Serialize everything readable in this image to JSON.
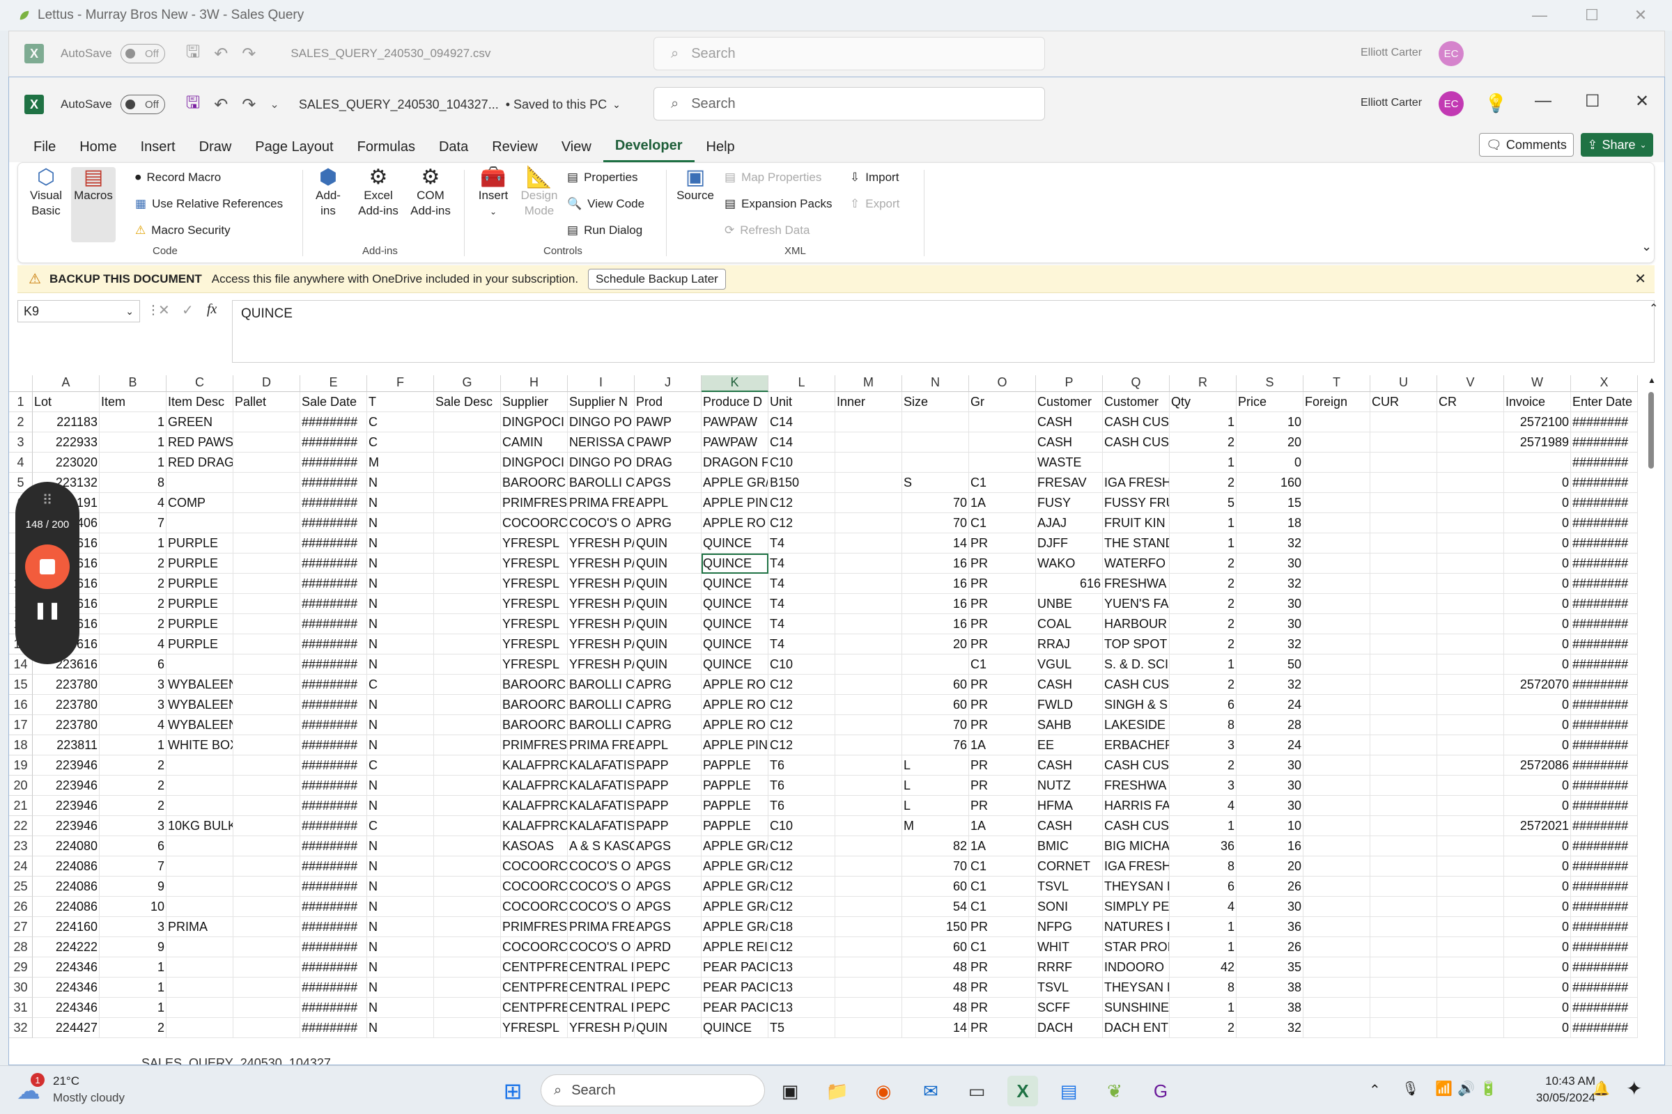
{
  "outer_window": {
    "title": "Lettus - Murray Bros New - 3W - Sales Query"
  },
  "back_window": {
    "autosave_label": "AutoSave",
    "autosave_state": "Off",
    "filename": "SALES_QUERY_240530_094927.csv",
    "search_placeholder": "Search",
    "user": "Elliott Carter",
    "user_initials": "EC"
  },
  "main_window": {
    "autosave_label": "AutoSave",
    "autosave_state": "Off",
    "filename": "SALES_QUERY_240530_104327...",
    "save_status": "• Saved to this PC",
    "search_placeholder": "Search",
    "user": "Elliott Carter",
    "user_initials": "EC"
  },
  "menu": [
    "File",
    "Home",
    "Insert",
    "Draw",
    "Page Layout",
    "Formulas",
    "Data",
    "Review",
    "View",
    "Developer",
    "Help"
  ],
  "menu_active_index": 9,
  "comments_label": "Comments",
  "share_label": "Share",
  "ribbon": {
    "visual_basic": "Visual Basic",
    "macros": "Macros",
    "record_macro": "Record Macro",
    "use_relative": "Use Relative References",
    "macro_security": "Macro Security",
    "code_group": "Code",
    "add_ins": "Add-ins",
    "excel_add_ins": "Excel Add-ins",
    "com_add_ins": "COM Add-ins",
    "add_ins_group": "Add-ins",
    "insert": "Insert",
    "design_mode": "Design Mode",
    "properties": "Properties",
    "view_code": "View Code",
    "run_dialog": "Run Dialog",
    "controls_group": "Controls",
    "source": "Source",
    "map_properties": "Map Properties",
    "expansion_packs": "Expansion Packs",
    "refresh_data": "Refresh Data",
    "import": "Import",
    "export": "Export",
    "xml_group": "XML"
  },
  "message_bar": {
    "title": "BACKUP THIS DOCUMENT",
    "text": "Access this file anywhere with OneDrive included in your subscription.",
    "button": "Schedule Backup Later"
  },
  "formula_bar": {
    "name_box": "K9",
    "fx": "fx",
    "content": "QUINCE"
  },
  "columns": [
    "A",
    "B",
    "C",
    "D",
    "E",
    "F",
    "G",
    "H",
    "I",
    "J",
    "K",
    "L",
    "M",
    "N",
    "O",
    "P",
    "Q",
    "R",
    "S",
    "T",
    "U",
    "V",
    "W",
    "X"
  ],
  "selected_column": "K",
  "active_cell": {
    "row": 9,
    "col": 10
  },
  "rows": [
    [
      "Lot",
      "Item",
      "Item Desc",
      "Pallet",
      "Sale Date",
      "T",
      "Sale Desc",
      "Supplier",
      "Supplier N",
      "Prod",
      "Produce D",
      "Unit",
      "Inner",
      "Size",
      "Gr",
      "Customer",
      "Customer",
      "Qty",
      "Price",
      "Foreign",
      "CUR",
      "CR",
      "Invoice",
      "Enter Date"
    ],
    [
      "221183",
      "1",
      "GREEN",
      "",
      "########",
      "C",
      "",
      "DINGPOCI",
      "DINGO PO",
      "PAWP",
      "PAWPAW",
      "C14",
      "",
      "",
      "",
      "CASH",
      "CASH CUS",
      "1",
      "10",
      "",
      "",
      "",
      "2572100",
      "########"
    ],
    [
      "222933",
      "1",
      "RED PAWS",
      "",
      "########",
      "C",
      "",
      "CAMIN",
      "NERISSA C",
      "PAWP",
      "PAWPAW",
      "C14",
      "",
      "",
      "",
      "CASH",
      "CASH CUS",
      "2",
      "20",
      "",
      "",
      "",
      "2571989",
      "########"
    ],
    [
      "223020",
      "1",
      "RED DRAGONFRUIT",
      "",
      "########",
      "M",
      "",
      "DINGPOCI",
      "DINGO PO",
      "DRAG",
      "DRAGON F",
      "C10",
      "",
      "",
      "",
      "WASTE",
      "",
      "1",
      "0",
      "",
      "",
      "",
      "",
      "########"
    ],
    [
      "223132",
      "8",
      "",
      "",
      "########",
      "N",
      "",
      "BAROORC",
      "BAROLLI C",
      "APGS",
      "APPLE GR/",
      "B150",
      "",
      "S",
      "C1",
      "FRESAV",
      "IGA FRESH",
      "2",
      "160",
      "",
      "",
      "",
      "0",
      "########"
    ],
    [
      "223191",
      "4",
      "COMP",
      "",
      "########",
      "N",
      "",
      "PRIMFRES",
      "PRIMA FRE",
      "APPL",
      "APPLE PIN",
      "C12",
      "",
      "70",
      "1A",
      "FUSY",
      "FUSSY FRU",
      "5",
      "15",
      "",
      "",
      "",
      "0",
      "########"
    ],
    [
      "223406",
      "7",
      "",
      "",
      "########",
      "N",
      "",
      "COCOORC",
      "COCO'S O",
      "APRG",
      "APPLE RO",
      "C12",
      "",
      "70",
      "C1",
      "AJAJ",
      "FRUIT KIN",
      "1",
      "18",
      "",
      "",
      "",
      "0",
      "########"
    ],
    [
      "223616",
      "1",
      "PURPLE",
      "",
      "########",
      "N",
      "",
      "YFRESPL",
      "YFRESH P/",
      "QUIN",
      "QUINCE",
      "T4",
      "",
      "14",
      "PR",
      "DJFF",
      "THE STAND",
      "1",
      "32",
      "",
      "",
      "",
      "0",
      "########"
    ],
    [
      "223616",
      "2",
      "PURPLE",
      "",
      "########",
      "N",
      "",
      "YFRESPL",
      "YFRESH P/",
      "QUIN",
      "QUINCE",
      "T4",
      "",
      "16",
      "PR",
      "WAKO",
      "WATERFO",
      "2",
      "30",
      "",
      "",
      "",
      "0",
      "########"
    ],
    [
      "223616",
      "2",
      "PURPLE",
      "",
      "########",
      "N",
      "",
      "YFRESPL",
      "YFRESH P/",
      "QUIN",
      "QUINCE",
      "T4",
      "",
      "16",
      "PR",
      "616",
      "FRESHWA",
      "2",
      "32",
      "",
      "",
      "",
      "0",
      "########"
    ],
    [
      "223616",
      "2",
      "PURPLE",
      "",
      "########",
      "N",
      "",
      "YFRESPL",
      "YFRESH P/",
      "QUIN",
      "QUINCE",
      "T4",
      "",
      "16",
      "PR",
      "UNBE",
      "YUEN'S FA",
      "2",
      "30",
      "",
      "",
      "",
      "0",
      "########"
    ],
    [
      "223616",
      "2",
      "PURPLE",
      "",
      "########",
      "N",
      "",
      "YFRESPL",
      "YFRESH P/",
      "QUIN",
      "QUINCE",
      "T4",
      "",
      "16",
      "PR",
      "COAL",
      "HARBOUR",
      "2",
      "30",
      "",
      "",
      "",
      "0",
      "########"
    ],
    [
      "223616",
      "4",
      "PURPLE",
      "",
      "########",
      "N",
      "",
      "YFRESPL",
      "YFRESH P/",
      "QUIN",
      "QUINCE",
      "T4",
      "",
      "20",
      "PR",
      "RRAJ",
      "TOP SPOT",
      "2",
      "32",
      "",
      "",
      "",
      "0",
      "########"
    ],
    [
      "223616",
      "6",
      "",
      "",
      "########",
      "N",
      "",
      "YFRESPL",
      "YFRESH P/",
      "QUIN",
      "QUINCE",
      "C10",
      "",
      "",
      "C1",
      "VGUL",
      "S. & D. SCI",
      "1",
      "50",
      "",
      "",
      "",
      "0",
      "########"
    ],
    [
      "223780",
      "3",
      "WYBALEENA",
      "",
      "########",
      "C",
      "",
      "BAROORC",
      "BAROLLI C",
      "APRG",
      "APPLE RO",
      "C12",
      "",
      "60",
      "PR",
      "CASH",
      "CASH CUS",
      "2",
      "32",
      "",
      "",
      "",
      "2572070",
      "########"
    ],
    [
      "223780",
      "3",
      "WYBALEENA",
      "",
      "########",
      "N",
      "",
      "BAROORC",
      "BAROLLI C",
      "APRG",
      "APPLE RO",
      "C12",
      "",
      "60",
      "PR",
      "FWLD",
      "SINGH & S",
      "6",
      "24",
      "",
      "",
      "",
      "0",
      "########"
    ],
    [
      "223780",
      "4",
      "WYBALEENA",
      "",
      "########",
      "N",
      "",
      "BAROORC",
      "BAROLLI C",
      "APRG",
      "APPLE RO",
      "C12",
      "",
      "70",
      "PR",
      "SAHB",
      "LAKESIDE",
      "8",
      "28",
      "",
      "",
      "",
      "0",
      "########"
    ],
    [
      "223811",
      "1",
      "WHITE BOX",
      "",
      "########",
      "N",
      "",
      "PRIMFRES",
      "PRIMA FRE",
      "APPL",
      "APPLE PIN",
      "C12",
      "",
      "76",
      "1A",
      "EE",
      "ERBACHER",
      "3",
      "24",
      "",
      "",
      "",
      "0",
      "########"
    ],
    [
      "223946",
      "2",
      "",
      "",
      "########",
      "C",
      "",
      "KALAFPRC",
      "KALAFATIS",
      "PAPP",
      "PAPPLE",
      "T6",
      "",
      "L",
      "PR",
      "CASH",
      "CASH CUS",
      "2",
      "30",
      "",
      "",
      "",
      "2572086",
      "########"
    ],
    [
      "223946",
      "2",
      "",
      "",
      "########",
      "N",
      "",
      "KALAFPRC",
      "KALAFATIS",
      "PAPP",
      "PAPPLE",
      "T6",
      "",
      "L",
      "PR",
      "NUTZ",
      "FRESHWA",
      "3",
      "30",
      "",
      "",
      "",
      "0",
      "########"
    ],
    [
      "223946",
      "2",
      "",
      "",
      "########",
      "N",
      "",
      "KALAFPRC",
      "KALAFATIS",
      "PAPP",
      "PAPPLE",
      "T6",
      "",
      "L",
      "PR",
      "HFMA",
      "HARRIS FA",
      "4",
      "30",
      "",
      "",
      "",
      "0",
      "########"
    ],
    [
      "223946",
      "3",
      "10KG BULK",
      "",
      "########",
      "C",
      "",
      "KALAFPRC",
      "KALAFATIS",
      "PAPP",
      "PAPPLE",
      "C10",
      "",
      "M",
      "1A",
      "CASH",
      "CASH CUS",
      "1",
      "10",
      "",
      "",
      "",
      "2572021",
      "########"
    ],
    [
      "224080",
      "6",
      "",
      "",
      "########",
      "N",
      "",
      "KASOAS",
      "A & S KASC",
      "APGS",
      "APPLE GR/",
      "C12",
      "",
      "82",
      "1A",
      "BMIC",
      "BIG MICHA",
      "36",
      "16",
      "",
      "",
      "",
      "0",
      "########"
    ],
    [
      "224086",
      "7",
      "",
      "",
      "########",
      "N",
      "",
      "COCOORC",
      "COCO'S O",
      "APGS",
      "APPLE GR/",
      "C12",
      "",
      "70",
      "C1",
      "CORNET",
      "IGA FRESH",
      "8",
      "20",
      "",
      "",
      "",
      "0",
      "########"
    ],
    [
      "224086",
      "9",
      "",
      "",
      "########",
      "N",
      "",
      "COCOORC",
      "COCO'S O",
      "APGS",
      "APPLE GR/",
      "C12",
      "",
      "60",
      "C1",
      "TSVL",
      "THEYSAN L",
      "6",
      "26",
      "",
      "",
      "",
      "0",
      "########"
    ],
    [
      "224086",
      "10",
      "",
      "",
      "########",
      "N",
      "",
      "COCOORC",
      "COCO'S O",
      "APGS",
      "APPLE GR/",
      "C12",
      "",
      "54",
      "C1",
      "SONI",
      "SIMPLY PE",
      "4",
      "30",
      "",
      "",
      "",
      "0",
      "########"
    ],
    [
      "224160",
      "3",
      "PRIMA",
      "",
      "########",
      "N",
      "",
      "PRIMFRES",
      "PRIMA FRE",
      "APGS",
      "APPLE GR/",
      "C18",
      "",
      "150",
      "PR",
      "NFPG",
      "NATURES I",
      "1",
      "36",
      "",
      "",
      "",
      "0",
      "########"
    ],
    [
      "224222",
      "9",
      "",
      "",
      "########",
      "N",
      "",
      "COCOORC",
      "COCO'S O",
      "APRD",
      "APPLE REI",
      "C12",
      "",
      "60",
      "C1",
      "WHIT",
      "STAR PROI",
      "1",
      "26",
      "",
      "",
      "",
      "0",
      "########"
    ],
    [
      "224346",
      "1",
      "",
      "",
      "########",
      "N",
      "",
      "CENTPFRE",
      "CENTRAL I",
      "PEPC",
      "PEAR PACI",
      "C13",
      "",
      "48",
      "PR",
      "RRRF",
      "INDOORO",
      "42",
      "35",
      "",
      "",
      "",
      "0",
      "########"
    ],
    [
      "224346",
      "1",
      "",
      "",
      "########",
      "N",
      "",
      "CENTPFRE",
      "CENTRAL I",
      "PEPC",
      "PEAR PACI",
      "C13",
      "",
      "48",
      "PR",
      "TSVL",
      "THEYSAN L",
      "8",
      "38",
      "",
      "",
      "",
      "0",
      "########"
    ],
    [
      "224346",
      "1",
      "",
      "",
      "########",
      "N",
      "",
      "CENTPFRE",
      "CENTRAL I",
      "PEPC",
      "PEAR PACI",
      "C13",
      "",
      "48",
      "PR",
      "SCFF",
      "SUNSHINE",
      "1",
      "38",
      "",
      "",
      "",
      "0",
      "########"
    ],
    [
      "224427",
      "2",
      "",
      "",
      "########",
      "N",
      "",
      "YFRESPL",
      "YFRESH P/",
      "QUIN",
      "QUINCE",
      "T5",
      "",
      "14",
      "PR",
      "DACH",
      "DACH ENT",
      "2",
      "32",
      "",
      "",
      "",
      "0",
      "########"
    ]
  ],
  "sheet_tab": "SALES_QUERY_240530_104327",
  "recorder": {
    "counter": "148 / 200"
  },
  "taskbar": {
    "weather_temp": "21°C",
    "weather_desc": "Mostly cloudy",
    "weather_badge": "1",
    "search_placeholder": "Search",
    "time": "10:43 AM",
    "date": "30/05/2024"
  }
}
